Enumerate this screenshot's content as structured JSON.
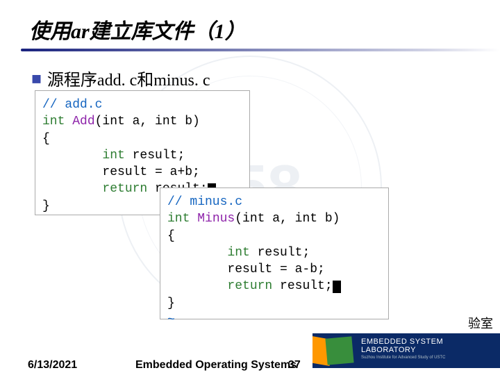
{
  "title": "使用ar建立库文件（1）",
  "bullet": {
    "icon": "◆",
    "text": "源程序add. c和minus. c"
  },
  "code": {
    "add": {
      "comment": "// add.c",
      "kw_int": "int",
      "fn": "Add",
      "sig_rest": "(int a, int b)",
      "open": "{",
      "l1a": "        int",
      "l1b": " result;",
      "l2": "        result = a+b;",
      "l3a": "        return",
      "l3b": " result;",
      "close": "}"
    },
    "minus": {
      "comment": "// minus.c",
      "kw_int": "int",
      "fn": "Minus",
      "sig_rest": "(int a, int b)",
      "open": "{",
      "l1a": "        int",
      "l1b": " result;",
      "l2": "        result = a-b;",
      "l3a": "        return",
      "l3b": " result;",
      "close": "}",
      "tilde": "~"
    }
  },
  "footer": {
    "date": "6/13/2021",
    "center": "Embedded Operating Systems",
    "page": "37",
    "lab_suffix": "验室",
    "logo_main": "EMBEDDED SYSTEM LABORATORY",
    "logo_sub": "Suzhou Institute for Advanced Study of USTC"
  }
}
